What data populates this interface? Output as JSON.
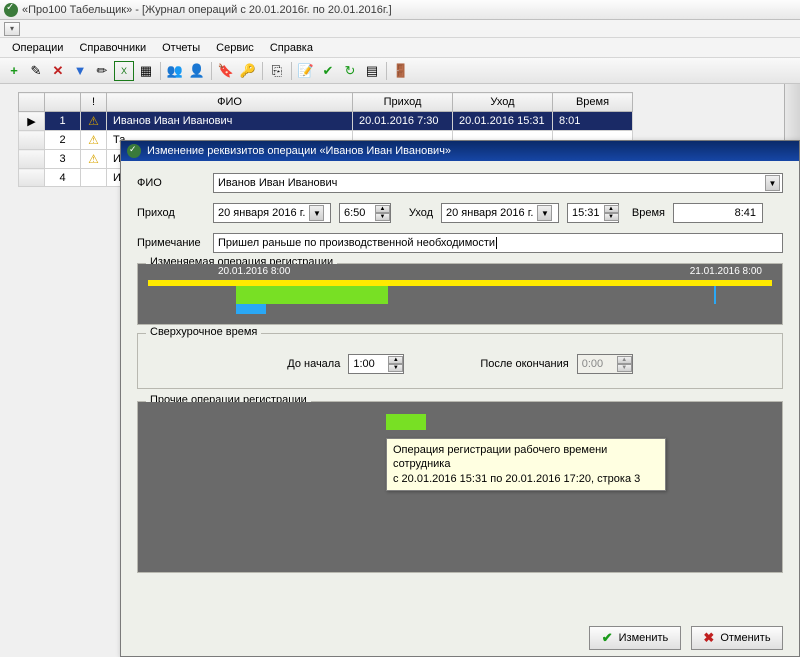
{
  "window": {
    "title": "«Про100 Табельщик» - [Журнал операций с 20.01.2016г. по 20.01.2016г.]"
  },
  "menu": {
    "operations": "Операции",
    "directories": "Справочники",
    "reports": "Отчеты",
    "service": "Сервис",
    "help": "Справка"
  },
  "grid": {
    "headers": {
      "blank": "",
      "num": "",
      "warn": "!",
      "fio": "ФИО",
      "arrive": "Приход",
      "leave": "Уход",
      "time": "Время"
    },
    "rows": [
      {
        "num": "1",
        "warn": true,
        "fio": "Иванов Иван Иванович",
        "arrive": "20.01.2016 7:30",
        "leave": "20.01.2016 15:31",
        "time": "8:01",
        "selected": true,
        "pointer": "▶"
      },
      {
        "num": "2",
        "warn": true,
        "fio": "Та",
        "arrive": "",
        "leave": "",
        "time": ""
      },
      {
        "num": "3",
        "warn": true,
        "fio": "Ив",
        "arrive": "",
        "leave": "",
        "time": ""
      },
      {
        "num": "4",
        "warn": false,
        "fio": "Ив",
        "arrive": "",
        "leave": "",
        "time": ""
      }
    ]
  },
  "dialog": {
    "title": "Изменение реквизитов операции «Иванов Иван Иванович»",
    "labels": {
      "fio": "ФИО",
      "arrive": "Приход",
      "leave": "Уход",
      "time": "Время",
      "note": "Примечание",
      "before_start": "До начала",
      "after_end": "После окончания"
    },
    "values": {
      "fio": "Иванов Иван Иванович",
      "arrive_date": "20  января  2016 г.",
      "arrive_time": "6:50",
      "leave_date": "20  января  2016 г.",
      "leave_time": "15:31",
      "duration": "8:41",
      "note": "Пришел раньше по производственной необходимости",
      "before_start": "1:00",
      "after_end": "0:00"
    },
    "groups": {
      "edited_op": "Изменяемая операция регистрации",
      "overtime": "Сверхурочное время",
      "other_ops": "Прочие операции регистрации"
    },
    "timeline": {
      "left_label": "20.01.2016 8:00",
      "right_label": "21.01.2016 8:00"
    },
    "tooltip": {
      "line1": "Операция регистрации рабочего времени сотрудника",
      "line2": "с 20.01.2016 15:31 по 20.01.2016 17:20, строка 3"
    },
    "buttons": {
      "ok": "Изменить",
      "cancel": "Отменить"
    }
  }
}
